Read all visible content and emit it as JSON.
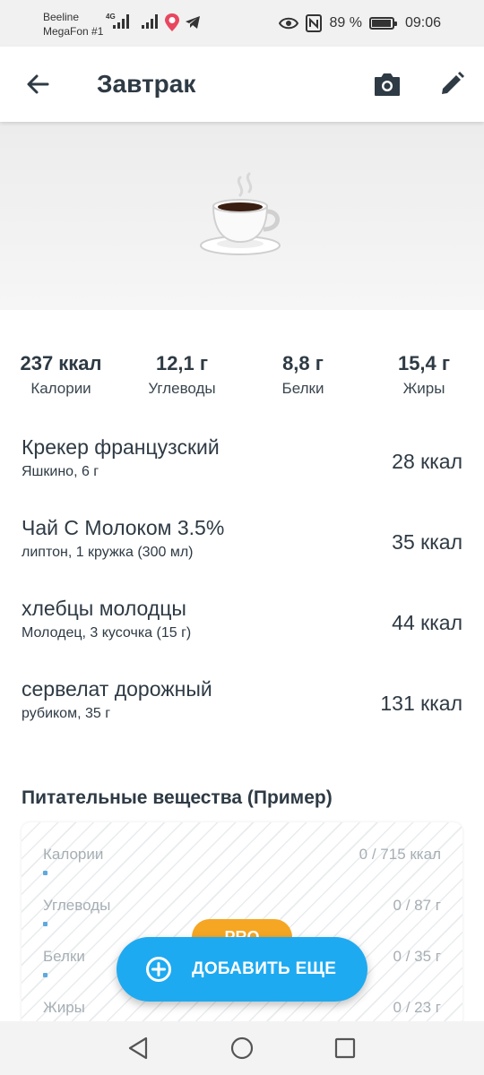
{
  "status_bar": {
    "carrier1": "Beeline",
    "carrier2": "MegaFon #1",
    "network": "4G",
    "battery_percent": "89 %",
    "time": "09:06"
  },
  "app_bar": {
    "title": "Завтрак",
    "icons": [
      "back-arrow-icon",
      "camera-icon",
      "pencil-icon"
    ]
  },
  "hero": {
    "icon": "coffee-cup-icon"
  },
  "summary": [
    {
      "value": "237 ккал",
      "label": "Калории"
    },
    {
      "value": "12,1 г",
      "label": "Углеводы"
    },
    {
      "value": "8,8 г",
      "label": "Белки"
    },
    {
      "value": "15,4 г",
      "label": "Жиры"
    }
  ],
  "foods": [
    {
      "name": "Крекер французский",
      "detail": "Яшкино, 6 г",
      "kcal": "28 ккал"
    },
    {
      "name": "Чай С Молоком 3.5%",
      "detail": "липтон, 1 кружка (300 мл)",
      "kcal": "35 ккал"
    },
    {
      "name": "хлебцы молодцы",
      "detail": "Молодец, 3 кусочка (15 г)",
      "kcal": "44 ккал"
    },
    {
      "name": "сервелат дорожный",
      "detail": "рубиком, 35 г",
      "kcal": "131 ккал"
    }
  ],
  "nutrients": {
    "title": "Питательные вещества (Пример)",
    "rows": [
      {
        "label": "Калории",
        "value": "0 / 715 ккал",
        "fraction": 0
      },
      {
        "label": "Углеводы",
        "value": "0 / 87 г",
        "fraction": 0
      },
      {
        "label": "Белки",
        "value": "0 / 35 г",
        "fraction": 0
      },
      {
        "label": "Жиры",
        "value": "0 / 23 г",
        "fraction": 0
      }
    ],
    "pro_badge": "PRO"
  },
  "fab": {
    "label": "ДОБАВИТЬ ЕЩЕ",
    "icon": "plus-circle-icon"
  },
  "nav_bar": {
    "icons": [
      "nav-back-icon",
      "nav-home-icon",
      "nav-recents-icon"
    ]
  },
  "colors": {
    "accent": "#1eaaf1",
    "pro": "#f5a623",
    "text": "#2e3a44"
  }
}
